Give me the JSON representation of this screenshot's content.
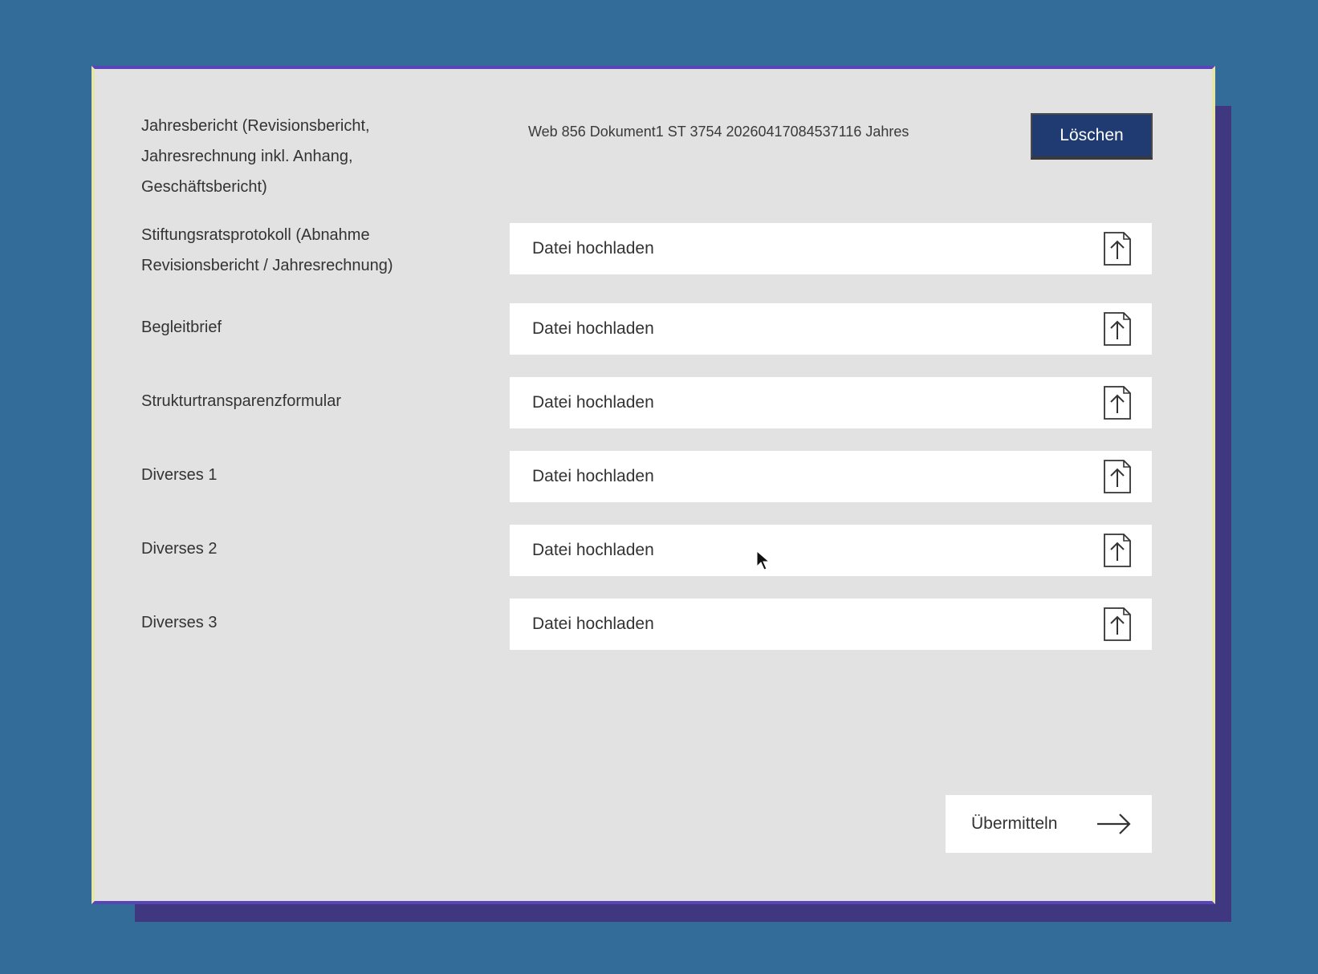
{
  "form": {
    "rows": [
      {
        "label": "Jahresbericht (Revisionsbericht, Jahresrechnung inkl. Anhang, Geschäftsbericht)",
        "filename": "Web 856 Dokument1 ST 3754 20260417084537116 Jahres",
        "delete_label": "Löschen"
      },
      {
        "label": "Stiftungsratsprotokoll (Abnahme Revisionsbericht / Jahresrechnung)",
        "placeholder": "Datei hochladen"
      },
      {
        "label": "Begleitbrief",
        "placeholder": "Datei hochladen"
      },
      {
        "label": "Strukturtransparenzformular",
        "placeholder": "Datei hochladen"
      },
      {
        "label": "Diverses 1",
        "placeholder": "Datei hochladen"
      },
      {
        "label": "Diverses 2",
        "placeholder": "Datei hochladen"
      },
      {
        "label": "Diverses 3",
        "placeholder": "Datei hochladen"
      }
    ],
    "submit_label": "Übermitteln"
  },
  "icons": {
    "upload": "file-upload-icon",
    "submit": "arrow-right-icon"
  },
  "colors": {
    "background": "#336b99",
    "panel": "#e2e2e2",
    "delete_button": "#1f3b72",
    "field": "#ffffff"
  }
}
